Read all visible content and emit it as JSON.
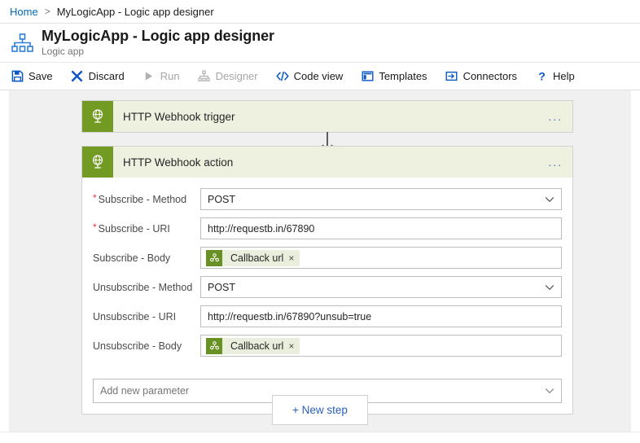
{
  "breadcrumb": {
    "home_label": "Home",
    "separator": ">",
    "current_label": "MyLogicApp - Logic app designer"
  },
  "header": {
    "icon": "logic-app-hierarchy-icon",
    "title": "MyLogicApp - Logic app designer",
    "subtitle": "Logic app"
  },
  "commandbar": {
    "items": [
      {
        "label": "Save",
        "icon": "save-floppy-icon",
        "state": "enabled"
      },
      {
        "label": "Discard",
        "icon": "close-x-icon",
        "state": "enabled"
      },
      {
        "label": "Run",
        "icon": "play-icon",
        "state": "disabled"
      },
      {
        "label": "Designer",
        "icon": "hierarchy-icon",
        "state": "disabled"
      },
      {
        "label": "Code view",
        "icon": "code-brackets-icon",
        "state": "enabled"
      },
      {
        "label": "Templates",
        "icon": "templates-icon",
        "state": "enabled"
      },
      {
        "label": "Connectors",
        "icon": "connectors-icon",
        "state": "enabled"
      },
      {
        "label": "Help",
        "icon": "question-mark-icon",
        "state": "enabled"
      }
    ]
  },
  "designer": {
    "trigger_card": {
      "title": "HTTP Webhook trigger",
      "icon": "globe-webhook-icon",
      "menu": "..."
    },
    "action_card": {
      "title": "HTTP Webhook action",
      "icon": "globe-webhook-icon",
      "menu": "...",
      "fields": [
        {
          "label": "Subscribe - Method",
          "required": true,
          "type": "select",
          "value": "POST"
        },
        {
          "label": "Subscribe - URI",
          "required": true,
          "type": "text",
          "value": "http://requestb.in/67890"
        },
        {
          "label": "Subscribe - Body",
          "required": false,
          "type": "token",
          "value": "Callback url"
        },
        {
          "label": "Unsubscribe - Method",
          "required": false,
          "type": "select",
          "value": "POST"
        },
        {
          "label": "Unsubscribe - URI",
          "required": false,
          "type": "text",
          "value": "http://requestb.in/67890?unsub=true"
        },
        {
          "label": "Unsubscribe - Body",
          "required": false,
          "type": "token",
          "value": "Callback url"
        }
      ],
      "add_parameter_label": "Add new parameter",
      "token_remove_label": "×"
    },
    "new_step_label": "+ New step"
  },
  "colors": {
    "accent_blue": "#0067b8",
    "connector_green": "#739b24",
    "card_header_green": "#eef0e0",
    "canvas_gray": "#f0f0f0",
    "required_red": "#e03a3a"
  }
}
